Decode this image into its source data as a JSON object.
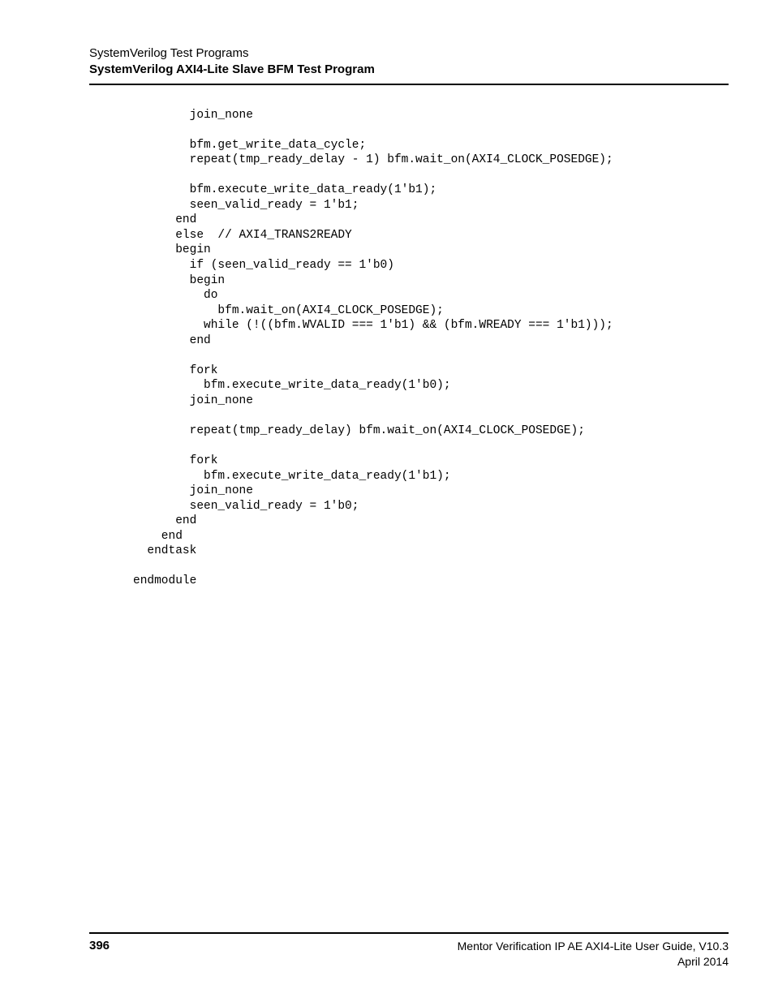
{
  "header": {
    "line1": "SystemVerilog Test Programs",
    "line2": "SystemVerilog AXI4-Lite Slave BFM Test Program"
  },
  "code": "        join_none\n\n        bfm.get_write_data_cycle;\n        repeat(tmp_ready_delay - 1) bfm.wait_on(AXI4_CLOCK_POSEDGE);\n\n        bfm.execute_write_data_ready(1'b1);\n        seen_valid_ready = 1'b1;\n      end\n      else  // AXI4_TRANS2READY\n      begin\n        if (seen_valid_ready == 1'b0)\n        begin\n          do\n            bfm.wait_on(AXI4_CLOCK_POSEDGE);\n          while (!((bfm.WVALID === 1'b1) && (bfm.WREADY === 1'b1)));\n        end\n\n        fork\n          bfm.execute_write_data_ready(1'b0);\n        join_none\n\n        repeat(tmp_ready_delay) bfm.wait_on(AXI4_CLOCK_POSEDGE);\n\n        fork\n          bfm.execute_write_data_ready(1'b1);\n        join_none\n        seen_valid_ready = 1'b0;\n      end\n    end\n  endtask\n\nendmodule",
  "footer": {
    "page_number": "396",
    "guide_title": "Mentor Verification IP AE AXI4-Lite User Guide, V10.3",
    "date": "April 2014"
  }
}
